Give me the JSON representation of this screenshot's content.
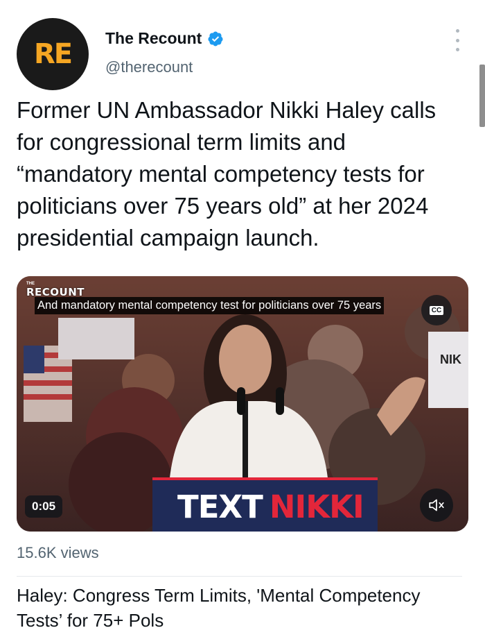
{
  "author": {
    "avatar_text": "RE",
    "display_name": "The Recount",
    "handle": "@therecount",
    "verified": true
  },
  "tweet": {
    "text": "Former UN Ambassador Nikki Haley calls for congressional term limits and “mandatory mental competency tests for politicians over 75 years old” at her 2024 presidential campaign launch."
  },
  "video": {
    "brand_small": "THE",
    "brand": "RECOUNT",
    "caption": "And mandatory mental competency test for politicians over 75 years",
    "cc_label": "CC",
    "time": "0:05",
    "podium_white": "TEXT",
    "podium_red": "NIKKI",
    "sign_text": "NIK"
  },
  "stats": {
    "views": "15.6K views"
  },
  "link_card": {
    "title": "Haley: Congress Term Limits, 'Mental Competency Tests’ for 75+ Pols"
  },
  "colors": {
    "accent_blue": "#1d9bf0",
    "avatar_orange": "#f5a623",
    "podium_red": "#e3263a",
    "secondary_text": "#536471"
  },
  "icons": {
    "verified": "verified-badge-icon",
    "more": "more-vertical-icon",
    "cc": "closed-captions-icon",
    "mute": "speaker-muted-icon"
  }
}
